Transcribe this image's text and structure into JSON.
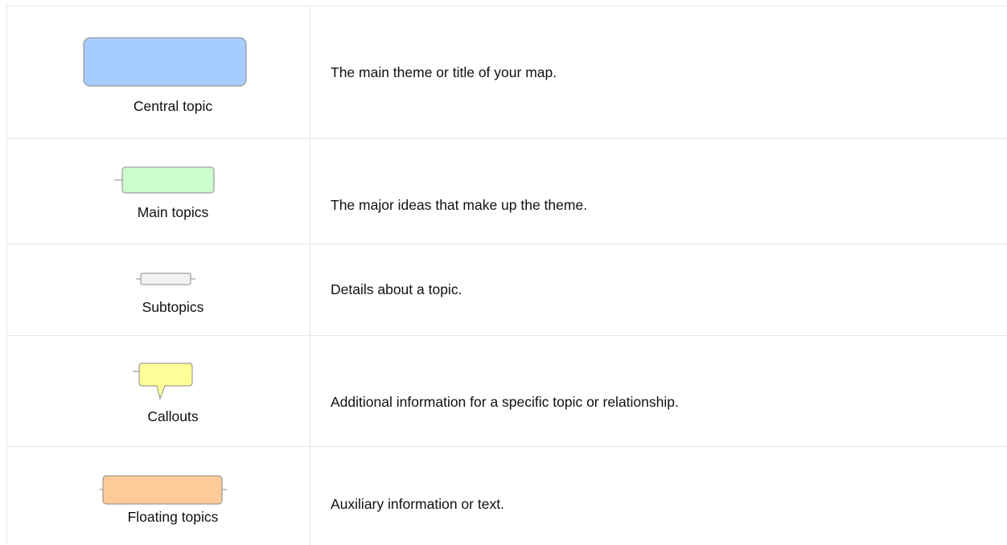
{
  "legend": {
    "rows": [
      {
        "label": "Central topic",
        "description": "The main theme or title of your map.",
        "shape_fill": "#a7ccff",
        "shape_stroke": "#8a8a8a"
      },
      {
        "label": "Main topics",
        "description": "The major ideas that make up the theme.",
        "shape_fill": "#ccffcc",
        "shape_stroke": "#8a8a8a"
      },
      {
        "label": "Subtopics",
        "description": "Details about a topic.",
        "shape_fill": "#f2f2f2",
        "shape_stroke": "#8a8a8a"
      },
      {
        "label": "Callouts",
        "description": "Additional information for a specific topic or relationship.",
        "shape_fill": "#ffff99",
        "shape_stroke": "#8a8a8a"
      },
      {
        "label": "Floating topics",
        "description": "Auxiliary information or text.",
        "shape_fill": "#ffcc99",
        "shape_stroke": "#8a8a8a"
      }
    ]
  }
}
